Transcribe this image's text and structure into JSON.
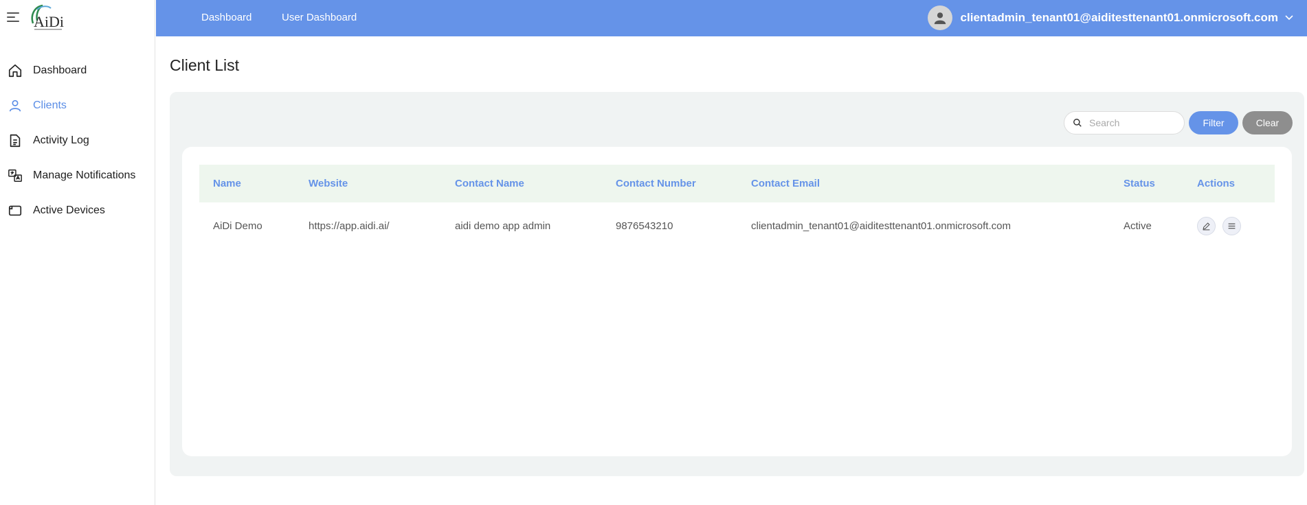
{
  "sidebar": {
    "logo_text": "AiDi",
    "items": [
      {
        "label": "Dashboard",
        "icon": "home-icon"
      },
      {
        "label": "Clients",
        "icon": "user-icon"
      },
      {
        "label": "Activity Log",
        "icon": "document-icon"
      },
      {
        "label": "Manage Notifications",
        "icon": "translate-icon"
      },
      {
        "label": "Active Devices",
        "icon": "device-icon"
      }
    ]
  },
  "topbar": {
    "links": [
      "Dashboard",
      "User Dashboard"
    ],
    "user_email": "clientadmin_tenant01@aiditesttenant01.onmicrosoft.com"
  },
  "page": {
    "title": "Client List"
  },
  "search": {
    "placeholder": "Search",
    "value": ""
  },
  "buttons": {
    "filter": "Filter",
    "clear": "Clear"
  },
  "table": {
    "headers": [
      "Name",
      "Website",
      "Contact Name",
      "Contact Number",
      "Contact Email",
      "Status",
      "Actions"
    ],
    "rows": [
      {
        "name": "AiDi Demo",
        "website": "https://app.aidi.ai/",
        "contact_name": "aidi demo app admin",
        "contact_number": "9876543210",
        "contact_email": "clientadmin_tenant01@aiditesttenant01.onmicrosoft.com",
        "status": "Active"
      }
    ]
  },
  "colors": {
    "accent": "#6593e8",
    "active_nav": "#5a8de6",
    "header_row": "#eef6ee",
    "panel": "#f0f3f3",
    "clear_button": "#8e8e8e"
  }
}
